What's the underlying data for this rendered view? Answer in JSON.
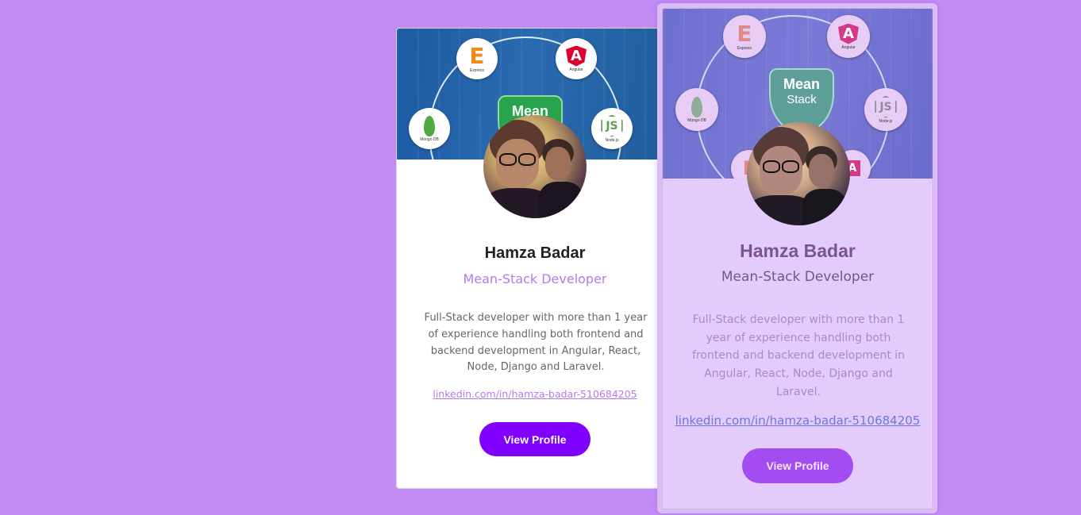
{
  "colors": {
    "background": "#c38cf5",
    "accent": "#7f00ff",
    "role_text": "#b678ee",
    "link": "#b678ee"
  },
  "banner": {
    "shield_title": "Mean",
    "shield_subtitle": "Stack",
    "techs": [
      {
        "icon": "express-icon",
        "glyph": "E",
        "label": "Express"
      },
      {
        "icon": "angular-icon",
        "glyph": "A",
        "label": "Angular"
      },
      {
        "icon": "mongodb-icon",
        "glyph": "",
        "label": "Mongo DB"
      },
      {
        "icon": "nodejs-icon",
        "glyph": "JS",
        "label": "Node.js"
      }
    ]
  },
  "profile": {
    "name": "Hamza Badar",
    "role": "Mean-Stack Developer",
    "bio": "Full-Stack developer with more than 1 year of experience handling both frontend and backend development in Angular, React, Node, Django and Laravel.",
    "link": "linkedin.com/in/hamza-badar-510684205",
    "button": "View Profile"
  }
}
